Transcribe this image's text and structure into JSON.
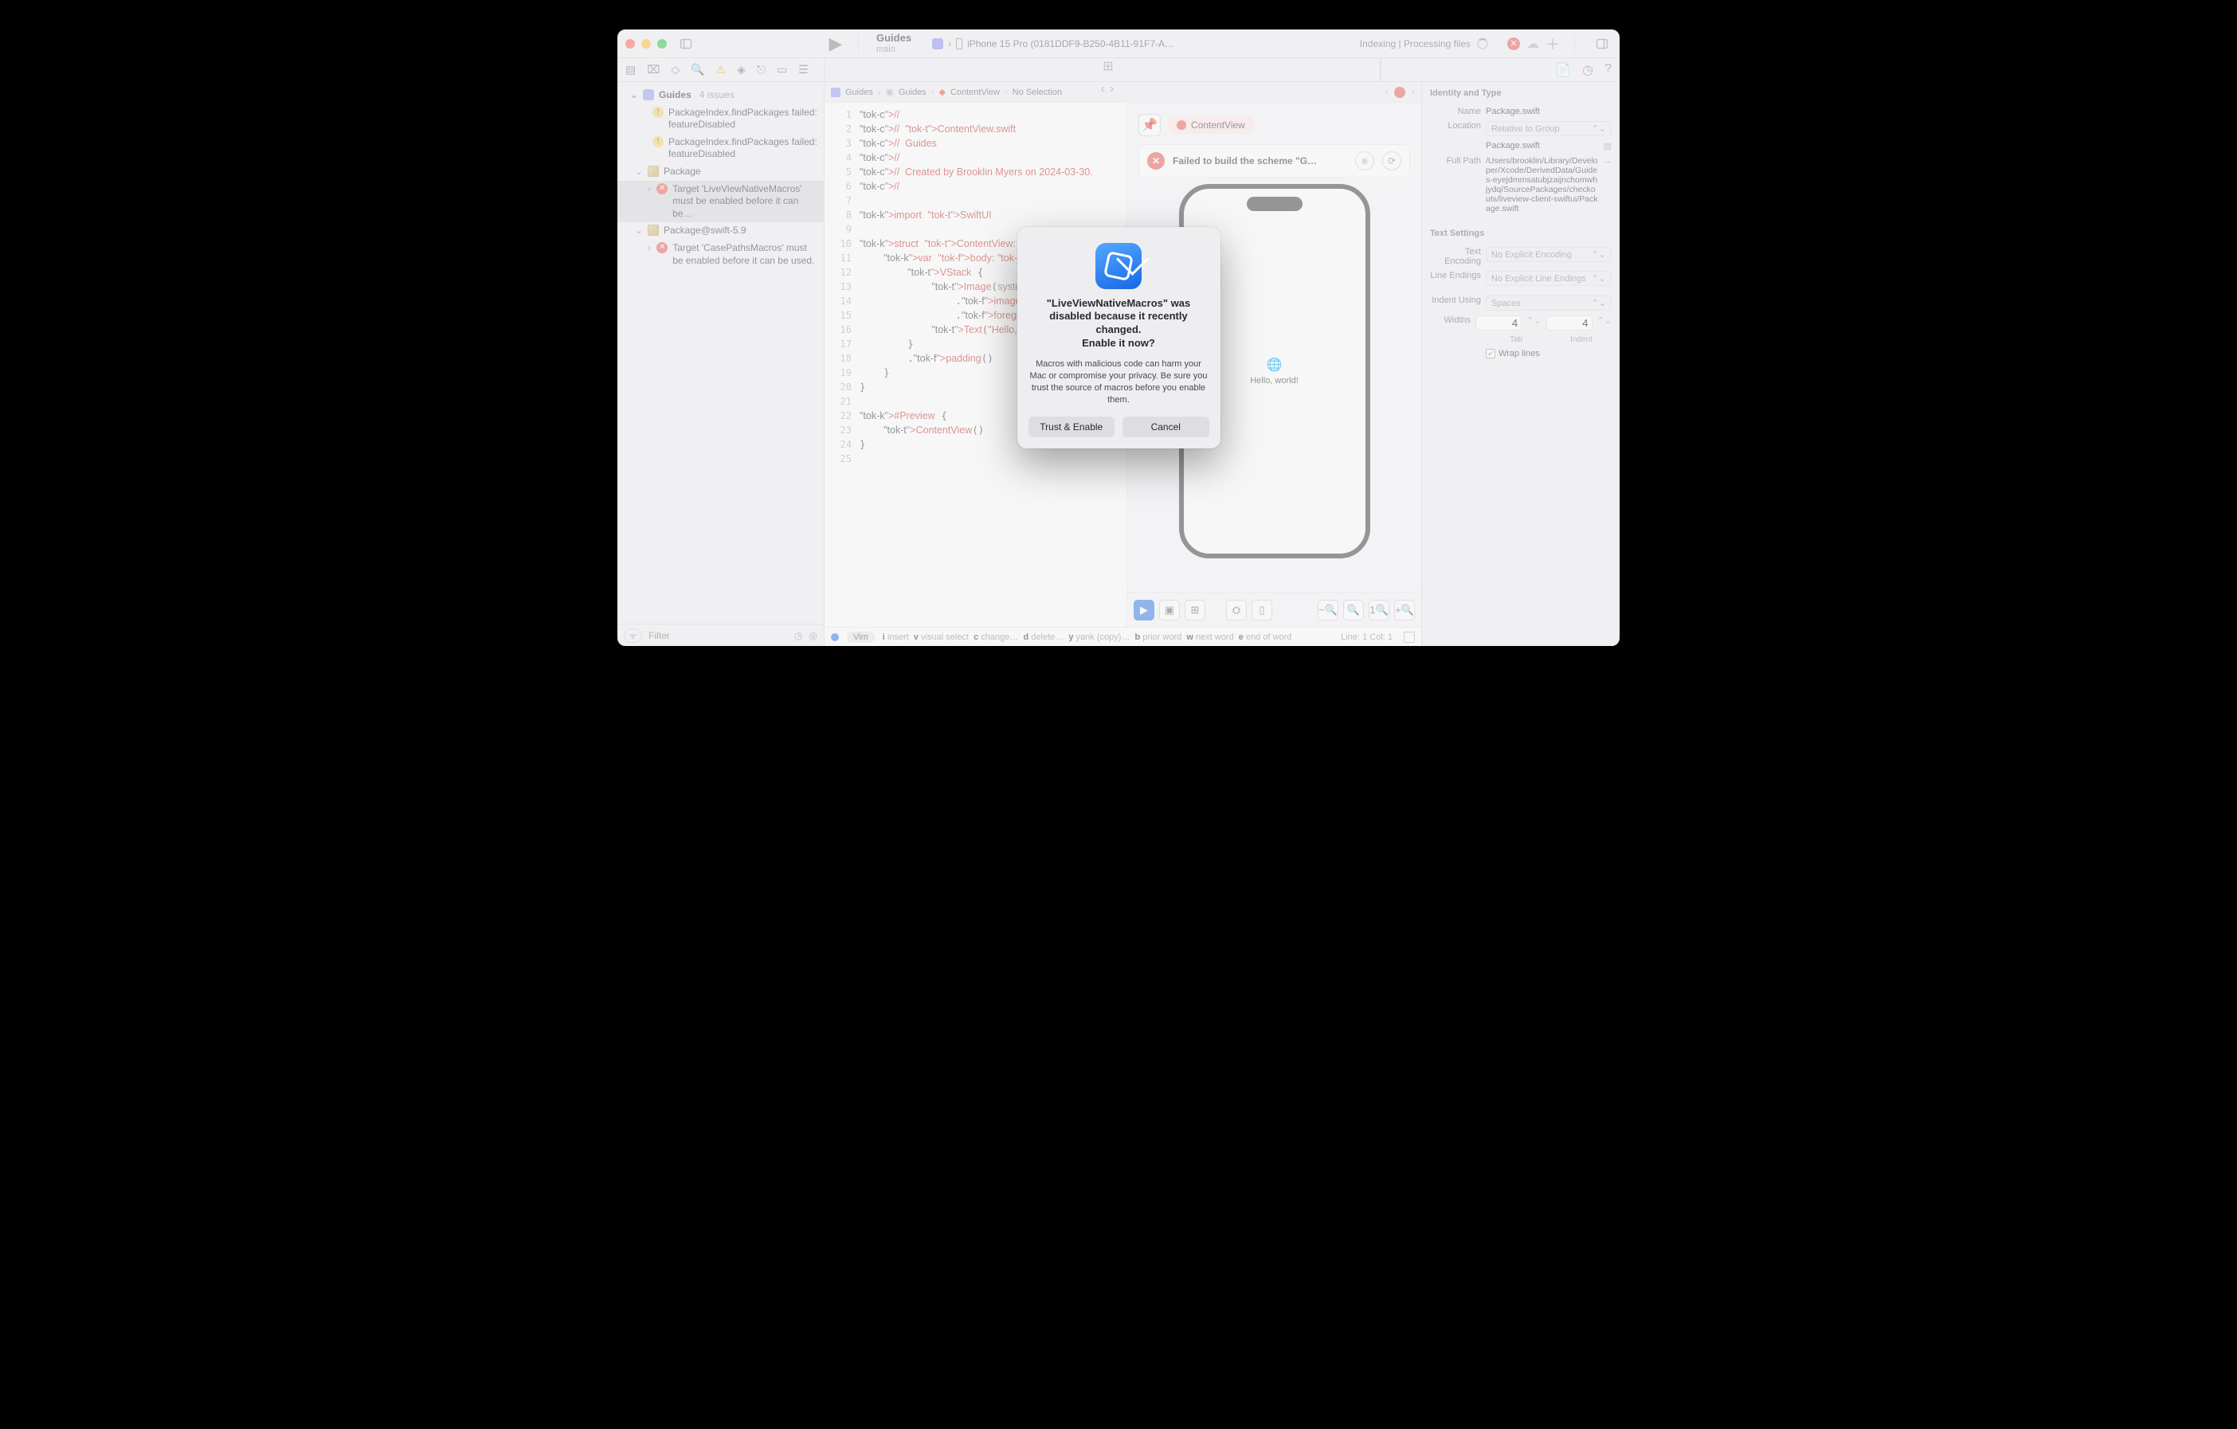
{
  "titlebar": {
    "scheme_name": "Guides",
    "branch": "main",
    "device": "iPhone 15 Pro (0181DDF9-B250-4B11-91F7-A…",
    "status": "Indexing | Processing files"
  },
  "tab": {
    "label": "ContentView"
  },
  "breadcrumb": {
    "items": [
      "Guides",
      "Guides",
      "ContentView",
      "No Selection"
    ]
  },
  "sidebar": {
    "header": {
      "name": "Guides",
      "count": "4 issues"
    },
    "items": [
      {
        "icon": "warn",
        "text": "PackageIndex.findPackages failed: featureDisabled"
      },
      {
        "icon": "warn",
        "text": "PackageIndex.findPackages failed: featureDisabled"
      }
    ],
    "groups": [
      {
        "name": "Package",
        "selected_child": "Target 'LiveViewNativeMacros' must be enabled before it can be…"
      },
      {
        "name": "Package@swift-5.9",
        "child": "Target 'CasePathsMacros' must be enabled before it can be used."
      }
    ],
    "filter_placeholder": "Filter"
  },
  "code": {
    "lines": [
      "//",
      "//  ContentView.swift",
      "//  Guides",
      "//",
      "//  Created by Brooklin Myers on 2024-03-30.",
      "//",
      "",
      "import SwiftUI",
      "",
      "struct ContentView: View",
      "    var body: some View",
      "        VStack {",
      "            Image(system",
      "                .imageSo",
      "                .foregro",
      "            Text(\"Hello,",
      "        }",
      "        .padding()",
      "    }",
      "}",
      "",
      "#Preview {",
      "    ContentView()",
      "}",
      " "
    ]
  },
  "preview": {
    "chip": "ContentView",
    "error": "Failed to build the scheme \"G…",
    "hello": "Hello, world!"
  },
  "footer": {
    "vim": "Vim",
    "kb": [
      {
        "k": "i",
        "t": "insert"
      },
      {
        "k": "v",
        "t": "visual select"
      },
      {
        "k": "c",
        "t": "change…"
      },
      {
        "k": "d",
        "t": "delete…"
      },
      {
        "k": "y",
        "t": "yank (copy)…"
      },
      {
        "k": "b",
        "t": "prior word"
      },
      {
        "k": "w",
        "t": "next word"
      },
      {
        "k": "e",
        "t": "end of word"
      }
    ],
    "pos": "Line: 1  Col: 1"
  },
  "inspector": {
    "section1": "Identity and Type",
    "name_label": "Name",
    "name_value": "Package.swift",
    "location_label": "Location",
    "location_value": "Relative to Group",
    "filename": "Package.swift",
    "fullpath_label": "Full Path",
    "fullpath_value": "/Users/brooklin/Library/Developer/Xcode/DerivedData/Guides-eyejdmmsatubjzaijnchomwhjydq/SourcePackages/checkouts/liveview-client-swiftui/Package.swift",
    "section2": "Text Settings",
    "enc_label": "Text Encoding",
    "enc_value": "No Explicit Encoding",
    "lines_label": "Line Endings",
    "lines_value": "No Explicit Line Endings",
    "indent_label": "Indent Using",
    "indent_value": "Spaces",
    "widths_label": "Widths",
    "tab_value": "4",
    "indent_value2": "4",
    "tab_sub": "Tab",
    "indent_sub": "Indent",
    "wrap": "Wrap lines"
  },
  "dialog": {
    "title_1": "\"LiveViewNativeMacros\" was disabled because it recently changed.",
    "title_2": "Enable it now?",
    "message": "Macros with malicious code can harm your Mac or compromise your privacy. Be sure you trust the source of macros before you enable them.",
    "trust": "Trust & Enable",
    "cancel": "Cancel"
  }
}
